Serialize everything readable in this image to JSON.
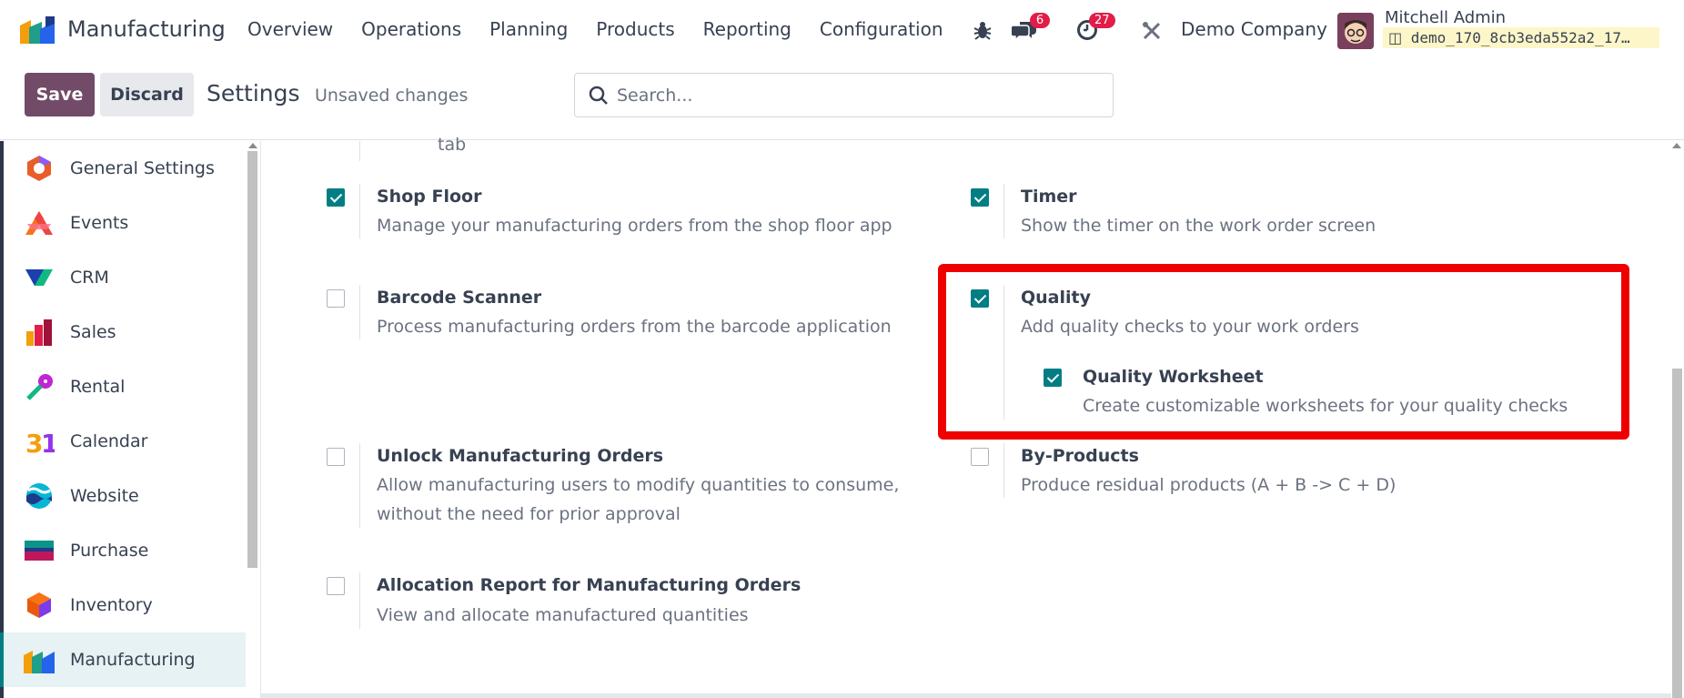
{
  "navbar": {
    "app_name": "Manufacturing",
    "menu": [
      "Overview",
      "Operations",
      "Planning",
      "Products",
      "Reporting",
      "Configuration"
    ],
    "messages_count": "6",
    "activities_count": "27",
    "company": "Demo Company",
    "user_name": "Mitchell Admin",
    "db_name": "demo_170_8cb3eda552a2_17…"
  },
  "control": {
    "save_label": "Save",
    "discard_label": "Discard",
    "title": "Settings",
    "unsaved": "Unsaved changes",
    "search_placeholder": "Search..."
  },
  "sidebar": {
    "items": [
      {
        "label": "General Settings",
        "icon": "general-settings-icon"
      },
      {
        "label": "Events",
        "icon": "events-icon"
      },
      {
        "label": "CRM",
        "icon": "crm-icon"
      },
      {
        "label": "Sales",
        "icon": "sales-icon"
      },
      {
        "label": "Rental",
        "icon": "rental-icon"
      },
      {
        "label": "Calendar",
        "icon": "calendar-icon"
      },
      {
        "label": "Website",
        "icon": "website-icon"
      },
      {
        "label": "Purchase",
        "icon": "purchase-icon"
      },
      {
        "label": "Inventory",
        "icon": "inventory-icon"
      },
      {
        "label": "Manufacturing",
        "icon": "manufacturing-icon",
        "active": true
      }
    ]
  },
  "settings": {
    "partial_text": "tab",
    "shop_floor": {
      "title": "Shop Floor",
      "desc": "Manage your manufacturing orders from the shop floor app",
      "checked": true
    },
    "timer": {
      "title": "Timer",
      "desc": "Show the timer on the work order screen",
      "checked": true
    },
    "barcode": {
      "title": "Barcode Scanner",
      "desc": "Process manufacturing orders from the barcode application",
      "checked": false
    },
    "quality": {
      "title": "Quality",
      "desc": "Add quality checks to your work orders",
      "checked": true
    },
    "quality_worksheet": {
      "title": "Quality Worksheet",
      "desc": "Create customizable worksheets for your quality checks",
      "checked": true
    },
    "unlock": {
      "title": "Unlock Manufacturing Orders",
      "desc1": "Allow manufacturing users to modify quantities to consume,",
      "desc2": "without the need for prior approval",
      "checked": false
    },
    "byproducts": {
      "title": "By-Products",
      "desc": "Produce residual products (A + B -> C + D)",
      "checked": false
    },
    "allocation": {
      "title": "Allocation Report for Manufacturing Orders",
      "desc": "View and allocate manufactured quantities",
      "checked": false
    }
  },
  "colors": {
    "primary": "#714b67",
    "accent": "#017e84",
    "highlight": "#ef0000",
    "badge": "#e11d48"
  }
}
